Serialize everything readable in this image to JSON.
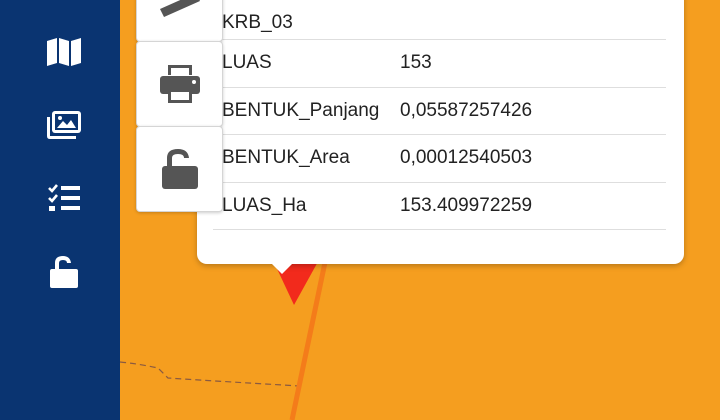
{
  "sidebar": {
    "items": [
      {
        "icon": "map-icon"
      },
      {
        "icon": "gallery-icon"
      },
      {
        "icon": "checklist-icon"
      },
      {
        "icon": "unlock-icon"
      }
    ]
  },
  "toolbar": {
    "items": [
      {
        "icon": "edit-icon"
      },
      {
        "icon": "print-icon"
      },
      {
        "icon": "unlock-icon"
      }
    ]
  },
  "popup": {
    "rows": [
      {
        "key": "KRB_03",
        "value": ""
      },
      {
        "key": "LUAS",
        "value": "153"
      },
      {
        "key": "BENTUK_Panjang",
        "value": "0,05587257426"
      },
      {
        "key": "BENTUK_Area",
        "value": "0,00012540503"
      },
      {
        "key": "LUAS_Ha",
        "value": "153.409972259"
      }
    ]
  },
  "colors": {
    "sidebar": "#0a3471",
    "map": "#f59e1f",
    "marker": "#f22a1c",
    "road": "#f47c1a"
  }
}
